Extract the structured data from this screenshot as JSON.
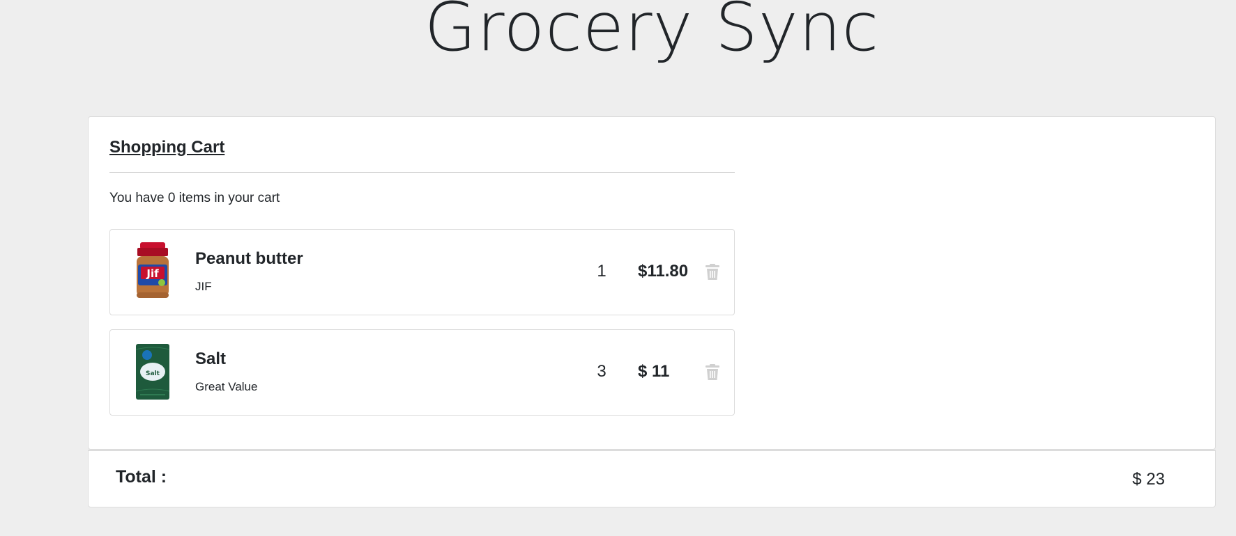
{
  "app": {
    "title": "Grocery Sync"
  },
  "cart": {
    "heading": "Shopping Cart",
    "count_text": "You have 0 items in your cart",
    "items": [
      {
        "name": "Peanut butter",
        "brand": "JIF",
        "quantity": "1",
        "price": "$11.80",
        "image_icon": "peanut-butter-jar-image",
        "image_colors": {
          "lid": "#c8102e",
          "jar": "#b9733a",
          "label": "#1f4aa8"
        }
      },
      {
        "name": "Salt",
        "brand": "Great Value",
        "quantity": "3",
        "price": "$ 11",
        "image_icon": "salt-bag-image",
        "image_colors": {
          "bag": "#1e5a3c",
          "label": "#e8f0f4"
        }
      }
    ],
    "delete_icon": "trash-icon",
    "delete_icon_color": "#d0d0d0"
  },
  "summary": {
    "total_label": "Total :",
    "total_value": "$ 23"
  },
  "colors": {
    "page_background": "#eeeeee",
    "card_background": "#ffffff",
    "text": "#212529",
    "border": "#dcdcdc"
  }
}
